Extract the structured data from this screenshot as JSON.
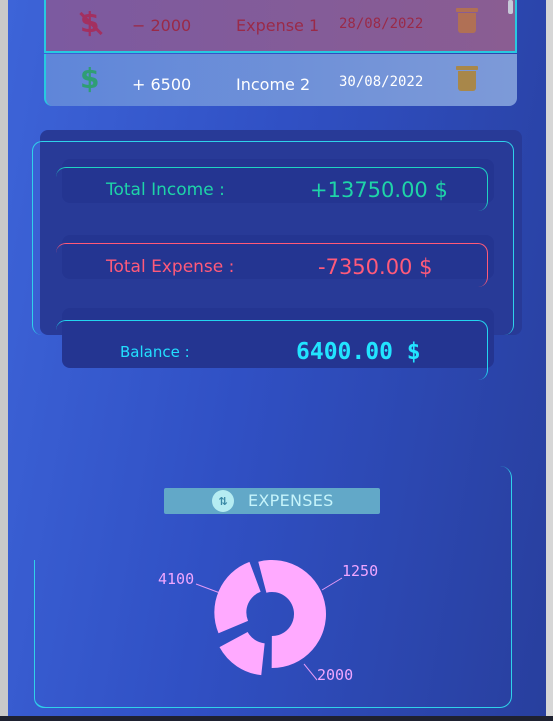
{
  "transactions": [
    {
      "type": "expense",
      "icon": "dollar-off-icon",
      "symbol": "$",
      "amount": "− 2000",
      "name": "Expense 1",
      "date": "28/08/2022"
    },
    {
      "type": "income",
      "icon": "dollar-icon",
      "symbol": "$",
      "amount": "+ 6500",
      "name": "Income 2",
      "date": "30/08/2022"
    }
  ],
  "summary": {
    "income_label": "Total Income :",
    "income_value": "+13750.00 $",
    "expense_label": "Total Expense :",
    "expense_value": "-7350.00 $",
    "balance_label": "Balance :",
    "balance_value": "6400.00 $"
  },
  "expenses_chart": {
    "header_icon": "swap-vertical-icon",
    "header_label": "EXPENSES",
    "colors": {
      "slice": "#ffaaff",
      "label": "#f0a6ff",
      "leader": "#e49af6"
    },
    "chart_data": {
      "type": "pie",
      "title": "EXPENSES",
      "values": [
        4100,
        1250,
        2000
      ],
      "labels": [
        "4100",
        "1250",
        "2000"
      ],
      "donut": true
    }
  },
  "colors": {
    "income": "#1ed4a8",
    "expense": "#ff5a7a",
    "balance": "#22e4ff",
    "frame": "#2fd2ea"
  }
}
